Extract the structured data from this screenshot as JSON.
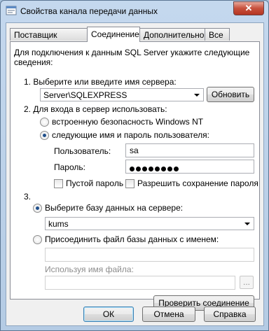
{
  "window": {
    "title": "Свойства канала передачи данных",
    "close_glyph": "✕"
  },
  "tabs": [
    {
      "label": "Поставщик данных"
    },
    {
      "label": "Соединение"
    },
    {
      "label": "Дополнительно"
    },
    {
      "label": "Все"
    }
  ],
  "intro": {
    "line1": "Для подключения к данным SQL Server укажите следующие",
    "line2": "сведения:"
  },
  "step1": {
    "label": "1. Выберите или введите имя сервера:",
    "server_value": "Server\\SQLEXPRESS",
    "refresh_button": "Обновить"
  },
  "step2": {
    "label": "2. Для входа в сервер использовать:",
    "opt_windows": "встроенную безопасность Windows NT",
    "opt_sql": "следующие имя и пароль пользователя:",
    "user_label": "Пользователь:",
    "user_value": "sa",
    "password_label": "Пароль:",
    "password_dot_count": 8,
    "blank_password": "Пустой пароль",
    "save_password": "Разрешить сохранение пароля"
  },
  "step3": {
    "number": "3.",
    "opt_select_db": "Выберите базу данных на сервере:",
    "db_value": "kums",
    "opt_attach": "Присоединить файл базы данных с именем:",
    "logical_name_label": "Используя имя файла:",
    "browse_button": "..."
  },
  "test_button": "Проверить соединение",
  "footer": {
    "ok": "ОК",
    "cancel": "Отмена",
    "help": "Справка"
  },
  "colors": {
    "window_frame": "#b4cbe4",
    "close_button": "#c7503c",
    "default_button_border": "#3c7fb1"
  }
}
